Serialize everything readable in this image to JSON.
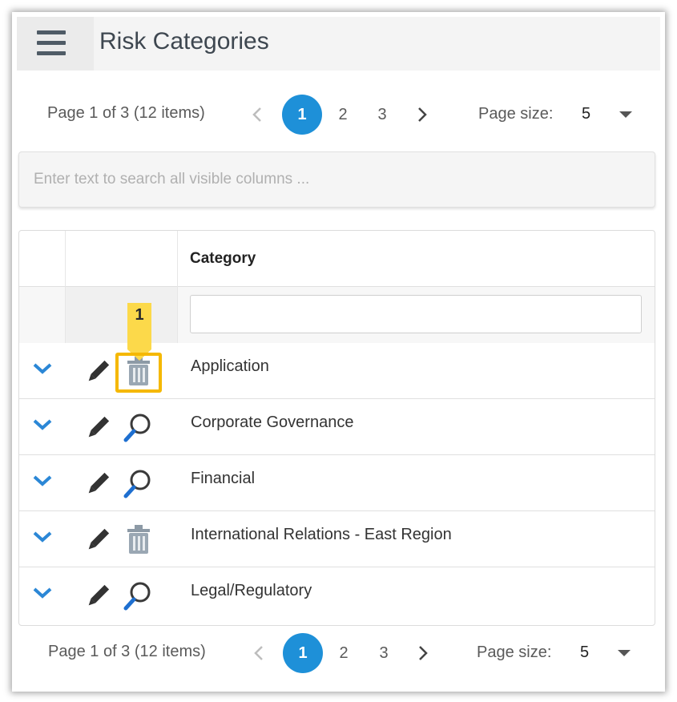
{
  "header": {
    "title": "Risk Categories",
    "menu_icon": "hamburger-menu-icon"
  },
  "pager_top": {
    "summary": "Page 1 of 3 (12 items)",
    "pages": [
      "1",
      "2",
      "3"
    ],
    "current_page": "1",
    "page_size_label": "Page size:",
    "page_size_value": "5"
  },
  "search": {
    "placeholder": "Enter text to search all visible columns ...",
    "value": ""
  },
  "grid": {
    "column_header": "Category",
    "filter_value": "",
    "rows": [
      {
        "category": "Application",
        "action_icon": "trash-icon"
      },
      {
        "category": "Corporate Governance",
        "action_icon": "magnifier-icon"
      },
      {
        "category": "Financial",
        "action_icon": "magnifier-icon"
      },
      {
        "category": "International Relations - East Region",
        "action_icon": "trash-icon"
      },
      {
        "category": "Legal/Regulatory",
        "action_icon": "magnifier-icon"
      }
    ]
  },
  "callout": {
    "number": "1",
    "color": "#f5b800"
  },
  "pager_bottom": {
    "summary": "Page 1 of 3 (12 items)",
    "pages": [
      "1",
      "2",
      "3"
    ],
    "current_page": "1",
    "page_size_label": "Page size:",
    "page_size_value": "5"
  },
  "colors": {
    "accent": "#1e90d8",
    "title": "#3e4750",
    "chevron": "#2b87d6",
    "highlight": "#f5b800"
  }
}
